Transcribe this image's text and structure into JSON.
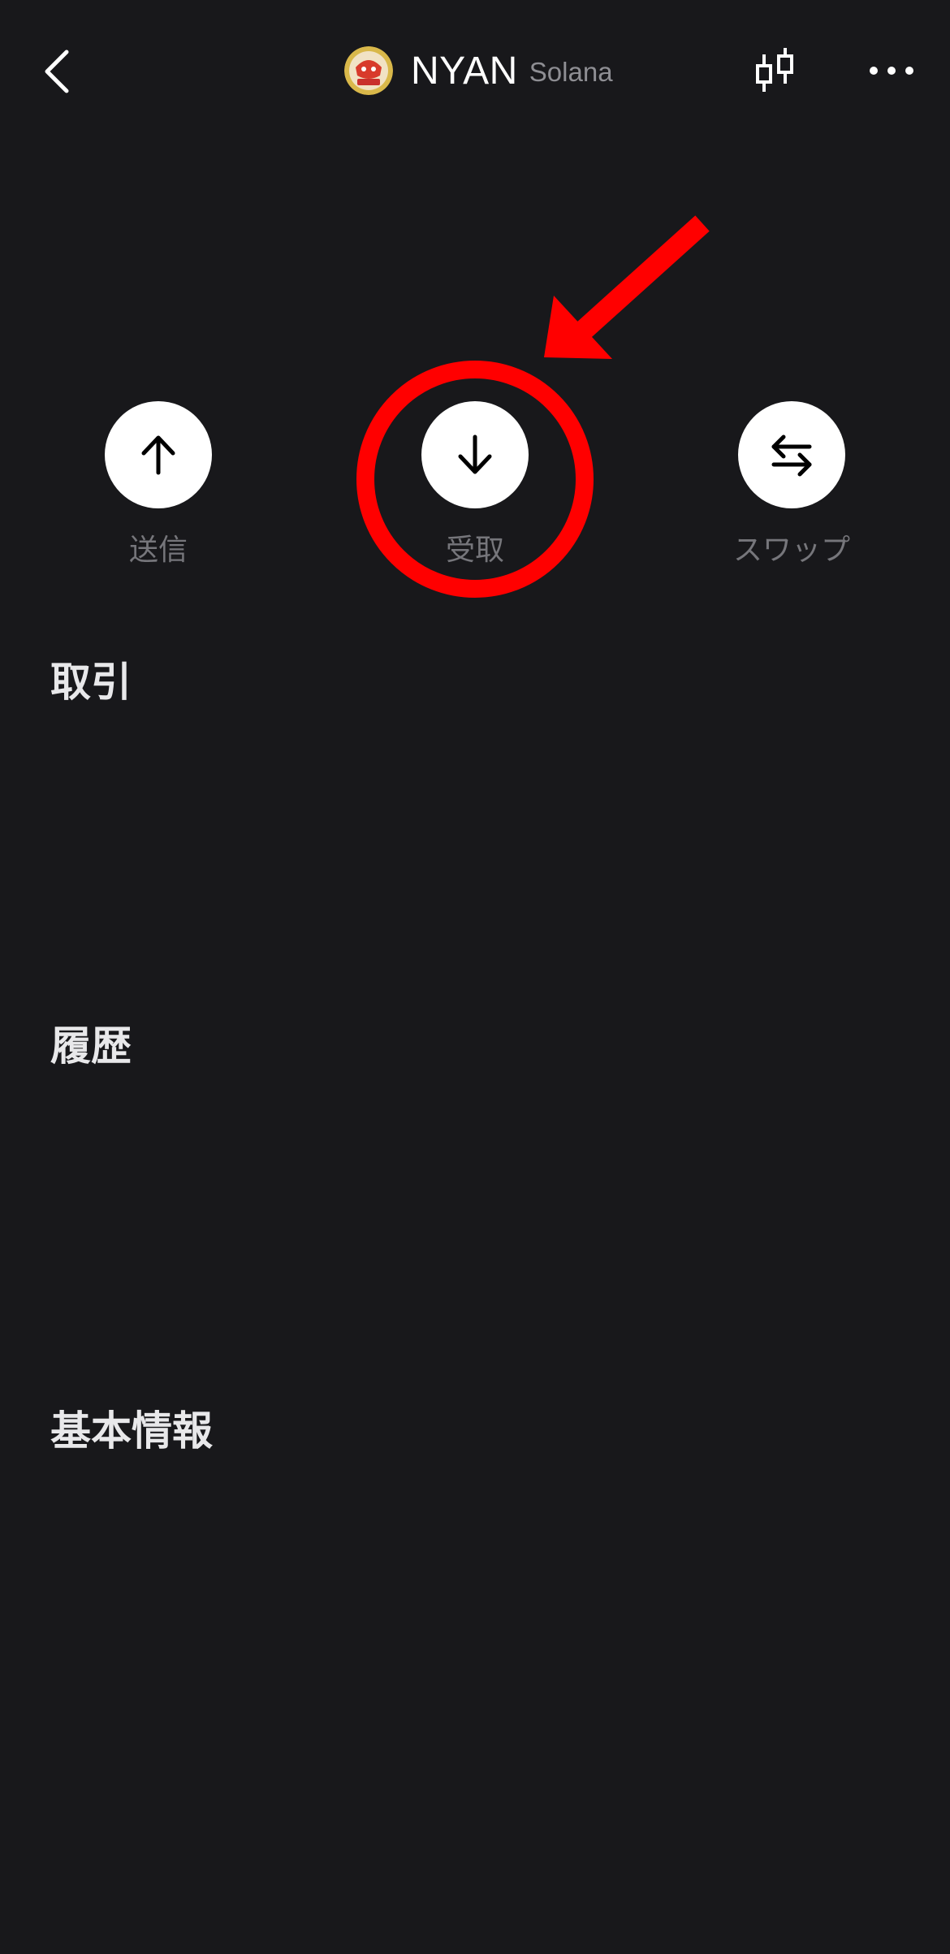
{
  "header": {
    "token_name": "NYAN",
    "chain": "Solana",
    "back_icon": "chevron-left-icon",
    "chart_icon": "candlestick-chart-icon",
    "more_icon": "more-horizontal-icon"
  },
  "actions": [
    {
      "label": "送信",
      "icon": "arrow-up-icon"
    },
    {
      "label": "受取",
      "icon": "arrow-down-icon"
    },
    {
      "label": "スワップ",
      "icon": "swap-arrows-icon"
    }
  ],
  "sections": {
    "trade": "取引",
    "history": "履歴",
    "info": "基本情報"
  },
  "colors": {
    "background": "#18181b",
    "annotation": "#ff0000",
    "label_gray": "#76767b"
  }
}
